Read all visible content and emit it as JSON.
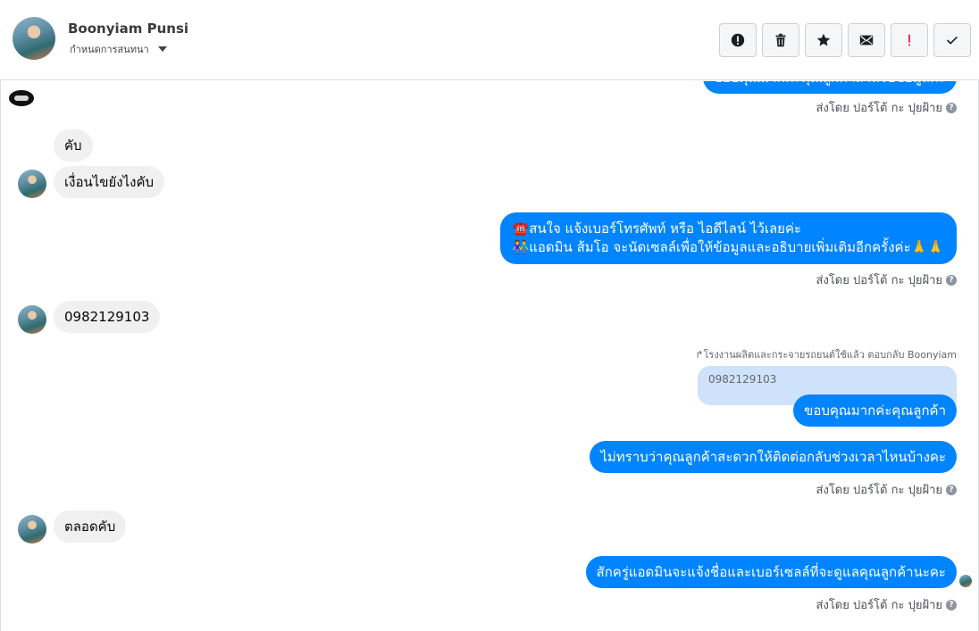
{
  "header": {
    "name": "Boonyiam Punsi",
    "subtitle": "กำหนดการสนทนา",
    "actions": [
      {
        "icon": "alert-circle-icon",
        "name": "mark-spam-button"
      },
      {
        "icon": "trash-icon",
        "name": "delete-button"
      },
      {
        "icon": "star-icon",
        "name": "star-button"
      },
      {
        "icon": "envelope-icon",
        "name": "mark-unread-button"
      },
      {
        "icon": "exclamation-icon",
        "name": "follow-up-button"
      },
      {
        "icon": "check-icon",
        "name": "done-button"
      }
    ]
  },
  "messages": {
    "top_partial": "ขอบคุณมากค่ะคุณลูกค้าสำหรับข้อมูลค่ะ",
    "sent_by_label": "ส่งโดย ปอร์โต้ กะ ปุยฝ้าย",
    "in1": "คับ",
    "in2": "เงื่อนไขยังไงคับ",
    "out1_line1": "☎️สนใจ แจ้งเบอร์โทรศัพท์ หรือ ไอดีไลน์  ไว้เลยค่ะ",
    "out1_line2": "👫แอดมิน ส้มโอ จะนัดเซลล์เพื่อให้ข้อมูลและอธิบายเพิ่มเติมอีกครั้งค่ะ🙏🙏",
    "in3": "0982129103",
    "reply_note": "↱โรงงานผลิตและกระจายรถยนต์ใช้แล้ว ตอบกลับ Boonyiam",
    "quoted": "0982129103",
    "out2": "ขอบคุณมากค่ะคุณลูกค้า",
    "out3": "ไม่ทราบว่าคุณลูกค้าสะดวกให้ติดต่อกลับช่วงเวลาไหนบ้างคะ",
    "in4": "ตลอดคับ",
    "out4": "สักครู่แอดมินจะแจ้งชื่อและเบอร์เซลล์ที่จะดูแลคุณลูกค้านะคะ"
  },
  "colors": {
    "outgoing": "#0084ff",
    "incoming": "#f0f0f0",
    "quoted": "#cfe2fb"
  }
}
